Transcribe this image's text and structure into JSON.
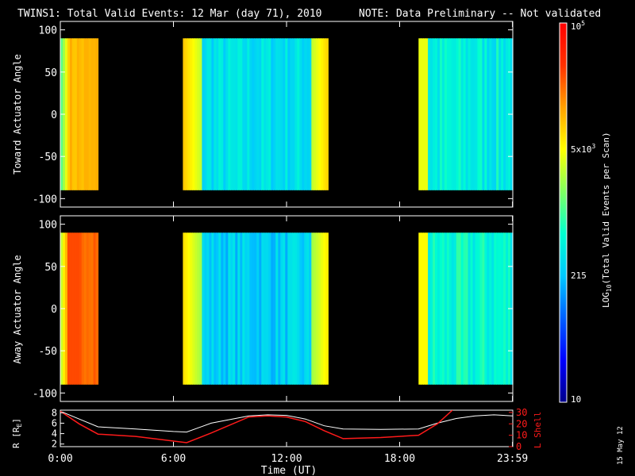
{
  "chart_data": {
    "type": "heatmap",
    "title": {
      "main": "TWINS1: Total Valid Events: 12 Mar (day  71), 2010",
      "note": "NOTE: Data Preliminary -- Not validated"
    },
    "colors": {
      "note": "#ff1a1a",
      "l_shell": "#ff1a1a",
      "r_line": "#ffffff",
      "background": "#000000"
    },
    "colorbar": {
      "label_prefix": "LOG",
      "label_sub": "10",
      "label_suffix": "(Total Valid Events per Scan)",
      "scale": "log",
      "range": [
        10,
        100000
      ],
      "tick_labels": [
        "10",
        "215",
        "5x10",
        "3",
        "10",
        "5"
      ],
      "colormap": [
        "#00008b",
        "#0000ff",
        "#0060ff",
        "#00c8ff",
        "#00ffd0",
        "#80ff60",
        "#ffff00",
        "#ffa000",
        "#ff3000",
        "#ff0000"
      ]
    },
    "panels": [
      {
        "ylabel": "Toward Actuator Angle",
        "ylim": [
          -110,
          110
        ],
        "yticks": [
          "100",
          "50",
          "0",
          "-50",
          "-100"
        ],
        "data_ylim": [
          -90,
          90
        ],
        "segments": [
          {
            "x": [
              0.0,
              2.0
            ],
            "level": 0.72
          },
          {
            "x": [
              6.5,
              14.2
            ],
            "level": 0.45
          },
          {
            "x": [
              19.0,
              24.0
            ],
            "level": 0.4
          }
        ]
      },
      {
        "ylabel": "Away Actuator Angle",
        "ylim": [
          -110,
          110
        ],
        "yticks": [
          "100",
          "50",
          "0",
          "-50",
          "-100"
        ],
        "data_ylim": [
          -90,
          90
        ],
        "segments": [
          {
            "x": [
              0.0,
              2.0
            ],
            "level": 0.82
          },
          {
            "x": [
              6.5,
              14.2
            ],
            "level": 0.42
          },
          {
            "x": [
              19.0,
              24.0
            ],
            "level": 0.42
          }
        ]
      }
    ],
    "orbit": {
      "ylabel_left": "R [R",
      "ylabel_left_sub": "E",
      "ylabel_left_end": "]",
      "ylabel_right": "L Shell",
      "ylim_left": [
        1.5,
        8.5
      ],
      "yticks_left": [
        "8",
        "6",
        "4",
        "2"
      ],
      "ylim_right": [
        0,
        32
      ],
      "yticks_right": [
        "30",
        "20",
        "10",
        "0"
      ],
      "r_series": {
        "x": [
          0,
          1,
          2,
          4,
          6,
          6.7,
          8,
          10,
          11,
          12,
          13,
          14,
          15,
          17,
          19,
          20,
          21,
          22,
          23,
          24
        ],
        "y": [
          8.3,
          6.8,
          5.3,
          4.9,
          4.4,
          4.3,
          6.0,
          7.4,
          7.6,
          7.5,
          6.8,
          5.5,
          4.9,
          4.8,
          4.9,
          6.0,
          6.9,
          7.4,
          7.6,
          7.4
        ]
      },
      "l_series": {
        "x": [
          0,
          1,
          2,
          4,
          6.7,
          8,
          10,
          11,
          12,
          13,
          14,
          15,
          17,
          19,
          20,
          20.8
        ],
        "y": [
          31,
          20,
          11,
          9,
          3.5,
          12,
          26,
          27,
          26,
          22,
          14,
          7,
          8,
          10,
          20,
          32
        ]
      }
    },
    "xaxis": {
      "label": "Time (UT)",
      "xlim": [
        0,
        24
      ],
      "ticks": [
        {
          "x": 0,
          "label": "0:00"
        },
        {
          "x": 6,
          "label": "6:00"
        },
        {
          "x": 12,
          "label": "12:00"
        },
        {
          "x": 18,
          "label": "18:00"
        },
        {
          "x": 23.983,
          "label": "23:59"
        }
      ]
    },
    "stamp": "15 May 12"
  }
}
